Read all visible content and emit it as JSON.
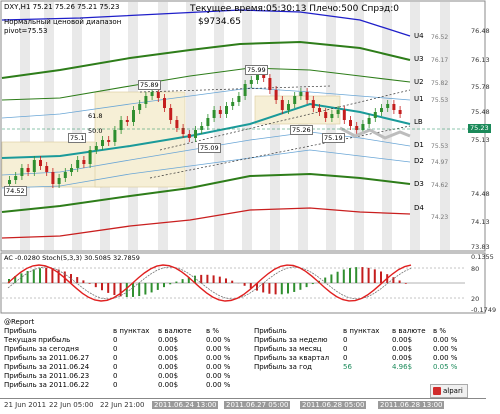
{
  "header": {
    "symbol_line": "DXY,H1  75.21 75.26 75.21 75.23",
    "status_line": "Текущее время:05:30:13 Плечо:500 Спрэд:0",
    "balance": "$9734.65",
    "indicator_name": "Нормальный ценовой диапазон",
    "pivot": "pivot=75.53"
  },
  "levels": {
    "U4": "U4",
    "U3": "U3",
    "U2": "U2",
    "U1": "U1",
    "LB": "LB",
    "D1": "D1",
    "D2": "D2",
    "D3": "D3",
    "D4": "D4",
    "U4_p": "76.52",
    "U3_p": "76.17",
    "U2_p": "75.82",
    "U1_p": "75.53",
    "D1_p": "75.53",
    "D2_p": "74.97",
    "D3_p": "74.62",
    "D4_p": "74.23"
  },
  "price_axis": [
    "76.48",
    "76.13",
    "75.78",
    "75.48",
    "75.13",
    "74.48",
    "74.13",
    "73.83"
  ],
  "current_price": "75.23",
  "current_price_color": "#1b8a5a",
  "annotations": {
    "p1": "75.89",
    "p2": "75.99",
    "p3": "75.26",
    "p4": "75.19",
    "p5": "75.09",
    "p6": "75.1",
    "p7": "74.52",
    "f1": "61.8",
    "f2": "50.0"
  },
  "oscillator": {
    "title": "AC -0.0280  Stoch(5,3,3) 30.5085 32.7859",
    "axis": [
      "0.1355",
      "80",
      "20",
      "-0.1749"
    ]
  },
  "report": {
    "title": "@Report",
    "left_headers": [
      "Прибыль",
      "в пунктах",
      "в валюте",
      "в %"
    ],
    "right_headers": [
      "Прибыль",
      "в пунктах",
      "в валюте",
      "в %"
    ],
    "left_rows": [
      [
        "Текущая прибыль",
        "0",
        "0.00$",
        "0.00 %"
      ],
      [
        "Прибыль за сегодня",
        "0",
        "0.00$",
        "0.00 %"
      ],
      [
        "Прибыль за 2011.06.27",
        "0",
        "0.00$",
        "0.00 %"
      ],
      [
        "Прибыль за 2011.06.24",
        "0",
        "0.00$",
        "0.00 %"
      ],
      [
        "Прибыль за 2011.06.23",
        "0",
        "0.00$",
        "0.00 %"
      ],
      [
        "Прибыль за 2011.06.22",
        "0",
        "0.00$",
        "0.00 %"
      ]
    ],
    "right_rows": [
      [
        "Прибыль за неделю",
        "0",
        "0.00$",
        "0.00 %"
      ],
      [
        "Прибыль за месяц",
        "0",
        "0.00$",
        "0.00 %"
      ],
      [
        "Прибыль за квартал",
        "0",
        "0.00$",
        "0.00 %"
      ],
      [
        "Прибыль за год",
        "56",
        "4.96$",
        "0.05 %"
      ]
    ],
    "brand": "alpari"
  },
  "time_axis": [
    "21 Jun 2011",
    "22 Jun 05:00",
    "22 Jun 21:00",
    "2011.06.24 13:00",
    "2011.06.27 05:00",
    "2011.06.28 05:00",
    "2011.06.28 13:00"
  ]
}
